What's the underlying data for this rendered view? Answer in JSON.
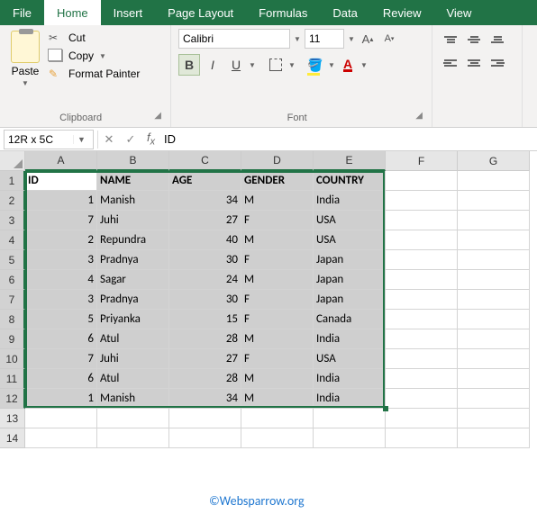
{
  "ribbon": {
    "tabs": [
      "File",
      "Home",
      "Insert",
      "Page Layout",
      "Formulas",
      "Data",
      "Review",
      "View"
    ],
    "active_tab": "Home",
    "clipboard": {
      "paste": "Paste",
      "cut": "Cut",
      "copy": "Copy",
      "painter": "Format Painter",
      "group_label": "Clipboard"
    },
    "font": {
      "name": "Calibri",
      "size": "11",
      "group_label": "Font"
    }
  },
  "namebox": "12R x 5C",
  "formula_value": "ID",
  "columns": [
    "A",
    "B",
    "C",
    "D",
    "E",
    "F",
    "G"
  ],
  "headers": [
    "ID",
    "NAME",
    "AGE",
    "GENDER",
    "COUNTRY"
  ],
  "rows": [
    {
      "id": "1",
      "name": "Manish",
      "age": "34",
      "gender": "M",
      "country": "India"
    },
    {
      "id": "7",
      "name": "Juhi",
      "age": "27",
      "gender": "F",
      "country": "USA"
    },
    {
      "id": "2",
      "name": "Repundra",
      "age": "40",
      "gender": "M",
      "country": "USA"
    },
    {
      "id": "3",
      "name": "Pradnya",
      "age": "30",
      "gender": "F",
      "country": "Japan"
    },
    {
      "id": "4",
      "name": "Sagar",
      "age": "24",
      "gender": "M",
      "country": "Japan"
    },
    {
      "id": "3",
      "name": "Pradnya",
      "age": "30",
      "gender": "F",
      "country": "Japan"
    },
    {
      "id": "5",
      "name": "Priyanka",
      "age": "15",
      "gender": "F",
      "country": "Canada"
    },
    {
      "id": "6",
      "name": "Atul",
      "age": "28",
      "gender": "M",
      "country": "India"
    },
    {
      "id": "7",
      "name": "Juhi",
      "age": "27",
      "gender": "F",
      "country": "USA"
    },
    {
      "id": "6",
      "name": "Atul",
      "age": "28",
      "gender": "M",
      "country": "India"
    },
    {
      "id": "1",
      "name": "Manish",
      "age": "34",
      "gender": "M",
      "country": "India"
    }
  ],
  "watermark": "©Websparrow.org"
}
